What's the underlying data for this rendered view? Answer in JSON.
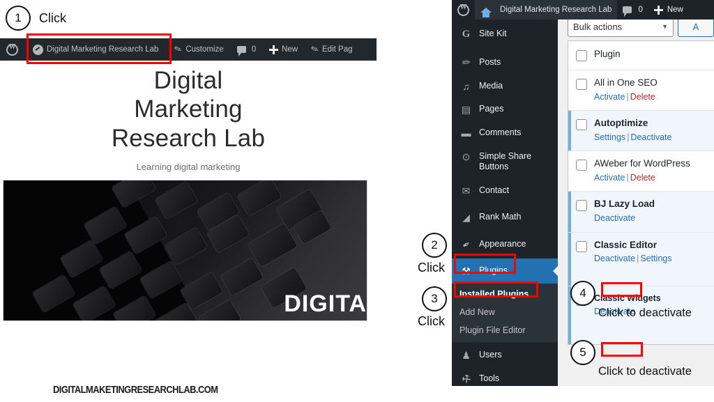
{
  "left_preview": {
    "admin_bar": {
      "wp_logo_icon": "wordpress-logo-icon",
      "site_icon": "dashboard-icon",
      "site_name": "Digital Marketing Research Lab",
      "customize_icon": "paintbrush-icon",
      "customize_label": "Customize",
      "comments_icon": "comment-bubble-icon",
      "comments_count": "0",
      "new_icon": "plus-icon",
      "new_label": "New",
      "edit_icon": "pencil-icon",
      "edit_label": "Edit Pag"
    },
    "hero": {
      "title_line1": "Digital",
      "title_line2": "Marketing",
      "title_line3": "Research Lab",
      "tagline": "Learning digital marketing",
      "image_alt": "laptop-keyboard-photo",
      "image_overlay_text": "DIGITA"
    },
    "watermark": "DIGITALMAKETINGRESEARCHLAB.COM"
  },
  "wp_admin": {
    "admin_bar": {
      "wp_logo_icon": "wordpress-logo-icon",
      "home_icon": "home-icon",
      "site_name": "Digital Marketing Research Lab",
      "comments_icon": "comment-bubble-icon",
      "comments_count": "0",
      "new_icon": "plus-icon",
      "new_label": "New"
    },
    "menu": [
      {
        "label": "Site Kit",
        "icon": "google-g-icon",
        "glyph": "G",
        "current": false
      },
      {
        "label": "Posts",
        "icon": "pin-icon",
        "glyph": "✐",
        "current": false
      },
      {
        "label": "Media",
        "icon": "media-icon",
        "glyph": "♫",
        "current": false
      },
      {
        "label": "Pages",
        "icon": "pages-icon",
        "glyph": "▤",
        "current": false
      },
      {
        "label": "Comments",
        "icon": "comment-bubble-icon",
        "glyph": "▬",
        "current": false
      },
      {
        "label": "Simple Share Buttons",
        "icon": "share-icon",
        "glyph": "⊙",
        "current": false
      },
      {
        "label": "Contact",
        "icon": "envelope-icon",
        "glyph": "✉",
        "current": false
      },
      {
        "label": "Rank Math",
        "icon": "rankmath-icon",
        "glyph": "◢",
        "current": false
      },
      {
        "label": "Appearance",
        "icon": "paintbrush-icon",
        "glyph": "✒",
        "current": false
      },
      {
        "label": "Plugins",
        "icon": "plug-icon",
        "glyph": "⚒",
        "current": true
      }
    ],
    "submenu": [
      {
        "label": "Installed Plugins",
        "current": true
      },
      {
        "label": "Add New",
        "current": false
      },
      {
        "label": "Plugin File Editor",
        "current": false
      }
    ],
    "menu_after_submenu": [
      {
        "label": "Users",
        "icon": "user-icon",
        "glyph": "♟"
      },
      {
        "label": "Tools",
        "icon": "wrench-icon",
        "glyph": "⚒"
      }
    ],
    "bulk_actions": {
      "selected": "Bulk actions",
      "caret_icon": "chevron-down-icon",
      "apply_label": "A"
    },
    "table": {
      "header": {
        "checkbox_icon": "checkbox-icon",
        "column_plugin": "Plugin"
      },
      "rows": [
        {
          "name": "All in One SEO",
          "active": false,
          "actions": [
            {
              "label": "Activate",
              "style": "link"
            },
            {
              "label": "Delete",
              "style": "danger"
            }
          ]
        },
        {
          "name": "Autoptimize",
          "active": true,
          "actions": [
            {
              "label": "Settings",
              "style": "link"
            },
            {
              "label": "Deactivate",
              "style": "link"
            }
          ]
        },
        {
          "name": "AWeber for WordPress",
          "active": false,
          "actions": [
            {
              "label": "Activate",
              "style": "link"
            },
            {
              "label": "Delete",
              "style": "danger"
            }
          ]
        },
        {
          "name": "BJ Lazy Load",
          "active": true,
          "actions": [
            {
              "label": "Deactivate",
              "style": "link"
            }
          ]
        },
        {
          "name": "Classic Editor",
          "active": true,
          "actions": [
            {
              "label": "Deactivate",
              "style": "link"
            },
            {
              "label": "Settings",
              "style": "link"
            }
          ]
        },
        {
          "name": "Classic Widgets",
          "active": true,
          "actions": [
            {
              "label": "Deactivate",
              "style": "link"
            }
          ]
        }
      ]
    }
  },
  "annotations": {
    "step1": {
      "number": "1",
      "label": "Click"
    },
    "step2": {
      "number": "2",
      "label": "Click"
    },
    "step3": {
      "number": "3",
      "label": "Click"
    },
    "step4": {
      "number": "4",
      "label": "Click to deactivate"
    },
    "step5": {
      "number": "5",
      "label": "Click to deactivate"
    },
    "highlight_color": "#ff0000"
  }
}
